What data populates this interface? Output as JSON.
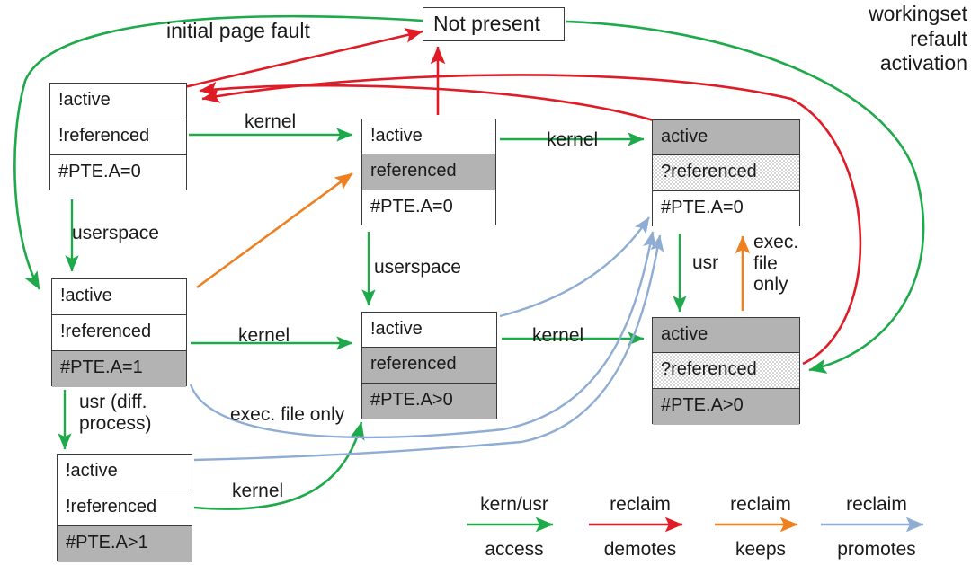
{
  "diagram": {
    "title_states": [
      {
        "id": "not-present",
        "label": "Not present"
      }
    ],
    "states": [
      {
        "id": "inactive-unref-a0",
        "rows": [
          {
            "text": "!active",
            "fill": "white"
          },
          {
            "text": "!referenced",
            "fill": "white"
          },
          {
            "text": "#PTE.A=0",
            "fill": "white"
          }
        ]
      },
      {
        "id": "inactive-unref-a1",
        "rows": [
          {
            "text": "!active",
            "fill": "white"
          },
          {
            "text": "!referenced",
            "fill": "white"
          },
          {
            "text": "#PTE.A=1",
            "fill": "gray"
          }
        ]
      },
      {
        "id": "inactive-unref-agt1",
        "rows": [
          {
            "text": "!active",
            "fill": "white"
          },
          {
            "text": "!referenced",
            "fill": "white"
          },
          {
            "text": "#PTE.A>1",
            "fill": "gray"
          }
        ]
      },
      {
        "id": "inactive-ref-a0",
        "rows": [
          {
            "text": "!active",
            "fill": "white"
          },
          {
            "text": "referenced",
            "fill": "gray"
          },
          {
            "text": "#PTE.A=0",
            "fill": "white"
          }
        ]
      },
      {
        "id": "inactive-ref-agt0",
        "rows": [
          {
            "text": "!active",
            "fill": "white"
          },
          {
            "text": "referenced",
            "fill": "gray"
          },
          {
            "text": "#PTE.A>0",
            "fill": "gray"
          }
        ]
      },
      {
        "id": "active-maybe-ref-a0",
        "rows": [
          {
            "text": "active",
            "fill": "gray"
          },
          {
            "text": "?referenced",
            "fill": "dotted"
          },
          {
            "text": "#PTE.A=0",
            "fill": "white"
          }
        ]
      },
      {
        "id": "active-maybe-ref-agt0",
        "rows": [
          {
            "text": "active",
            "fill": "gray"
          },
          {
            "text": "?referenced",
            "fill": "dotted"
          },
          {
            "text": "#PTE.A>0",
            "fill": "gray"
          }
        ]
      }
    ],
    "edge_labels": {
      "initial_page_fault": "initial page fault",
      "workingset_refault_activation": "workingset\nrefault\nactivation",
      "kernel_1": "kernel",
      "kernel_2": "kernel",
      "kernel_3": "kernel",
      "kernel_4": "kernel",
      "kernel_5": "kernel",
      "userspace_1": "userspace",
      "userspace_2": "userspace",
      "usr_diff_process": "usr (diff.\nprocess)",
      "usr": "usr",
      "exec_file_only_vertical": "exec.\nfile\nonly",
      "exec_file_only_diagonal": "exec. file only"
    },
    "legend": [
      {
        "top": "kern/usr",
        "bottom": "access",
        "color": "#1eaa4b"
      },
      {
        "top": "reclaim",
        "bottom": "demotes",
        "color": "#e01b26"
      },
      {
        "top": "reclaim",
        "bottom": "keeps",
        "color": "#ef8020"
      },
      {
        "top": "reclaim",
        "bottom": "promotes",
        "color": "#8fadd4"
      }
    ],
    "colors": {
      "green": "#1eaa4b",
      "red": "#e01b26",
      "orange": "#ef8020",
      "blue": "#8fadd4",
      "box_border": "#3a3a3a",
      "gray_fill": "#b3b3b3",
      "text": "#1a1a1a",
      "background": "#ffffff"
    }
  }
}
